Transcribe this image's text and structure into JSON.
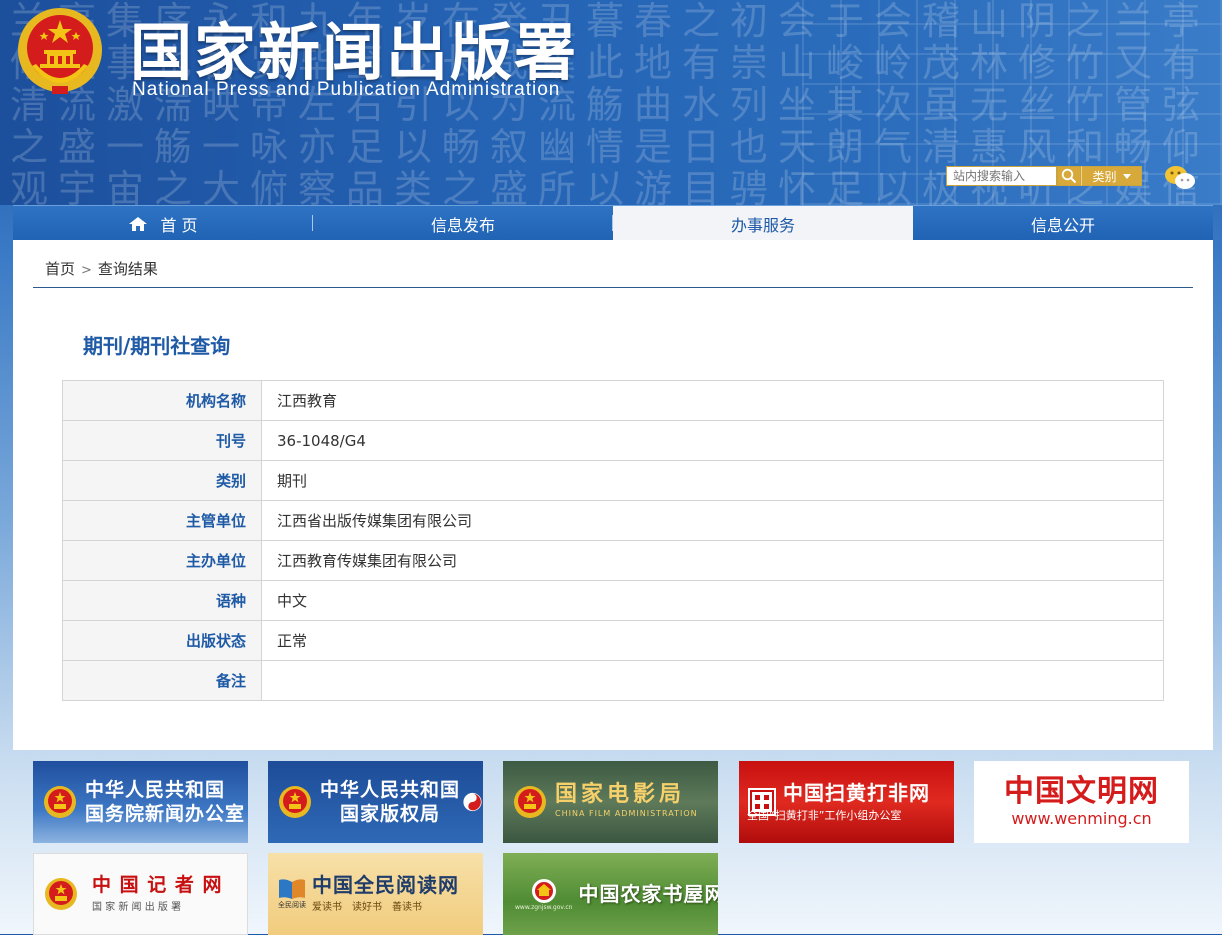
{
  "header": {
    "site_title": "国家新闻出版署",
    "site_subtitle": "National  Press and Publication Administration",
    "search_placeholder": "站内搜索输入",
    "category_label": "类别",
    "calligraphy_bg": "兰亭集序永和九年岁在癸丑暮春之初会于会稽山阴之兰亭修禊事也群贤毕至少长咸集此地有崇山峻岭茂林修竹又有清流激湍映带左右引以为流觞曲水列坐其次虽无丝竹管弦之盛一觞一咏亦足以畅叙幽情是日也天朗气清惠风和畅仰观宇宙之大俯察品类之盛所以游目骋怀足以极视听之娱信可乐也夫人之相与俯仰一世或取诸怀抱悟言一室之内或因寄所托放浪形骸之外"
  },
  "nav": {
    "items": [
      {
        "label": "首 页",
        "icon": "home-icon"
      },
      {
        "label": "信息发布"
      },
      {
        "label": "办事服务",
        "active": true
      },
      {
        "label": "信息公开"
      }
    ]
  },
  "breadcrumb": {
    "home": "首页",
    "separator": ">",
    "current": "查询结果"
  },
  "query": {
    "title": "期刊/期刊社查询",
    "rows": [
      {
        "key": "机构名称",
        "value": "江西教育"
      },
      {
        "key": "刊号",
        "value": "36-1048/G4"
      },
      {
        "key": "类别",
        "value": "期刊"
      },
      {
        "key": "主管单位",
        "value": "江西省出版传媒集团有限公司"
      },
      {
        "key": "主办单位",
        "value": "江西教育传媒集团有限公司"
      },
      {
        "key": "语种",
        "value": "中文"
      },
      {
        "key": "出版状态",
        "value": "正常"
      },
      {
        "key": "备注",
        "value": ""
      }
    ]
  },
  "links": {
    "scio": {
      "line1": "中华人民共和国",
      "line2": "国务院新闻办公室"
    },
    "ncac": {
      "line1": "中华人民共和国",
      "line2": "国家版权局"
    },
    "film": {
      "line1": "国家电影局",
      "line2": "CHINA FILM ADMINISTRATION"
    },
    "shdf": {
      "line1": "中国扫黄打非网",
      "line2": "全国“扫黄打非”工作小组办公室"
    },
    "wenming": {
      "line1": "中国文明网",
      "line2": "www.wenming.cn"
    },
    "jizhe": {
      "line1": "中 国 记 者 网",
      "line2": "国 家 新 闻 出 版 署"
    },
    "reading": {
      "line1": "中国全民阅读网",
      "badge": "全民阅读",
      "line2": "爱读书　读好书　善读书"
    },
    "nongjia": {
      "line1": "中国农家书屋网",
      "line2": "www.zgnjsw.gov.cn"
    }
  },
  "colors": {
    "nav_blue": "#2062b3",
    "title_blue": "#1f5aa6",
    "search_gold": "#d7a93b",
    "emblem_red": "#d41c1c",
    "emblem_gold": "#f3c316"
  }
}
